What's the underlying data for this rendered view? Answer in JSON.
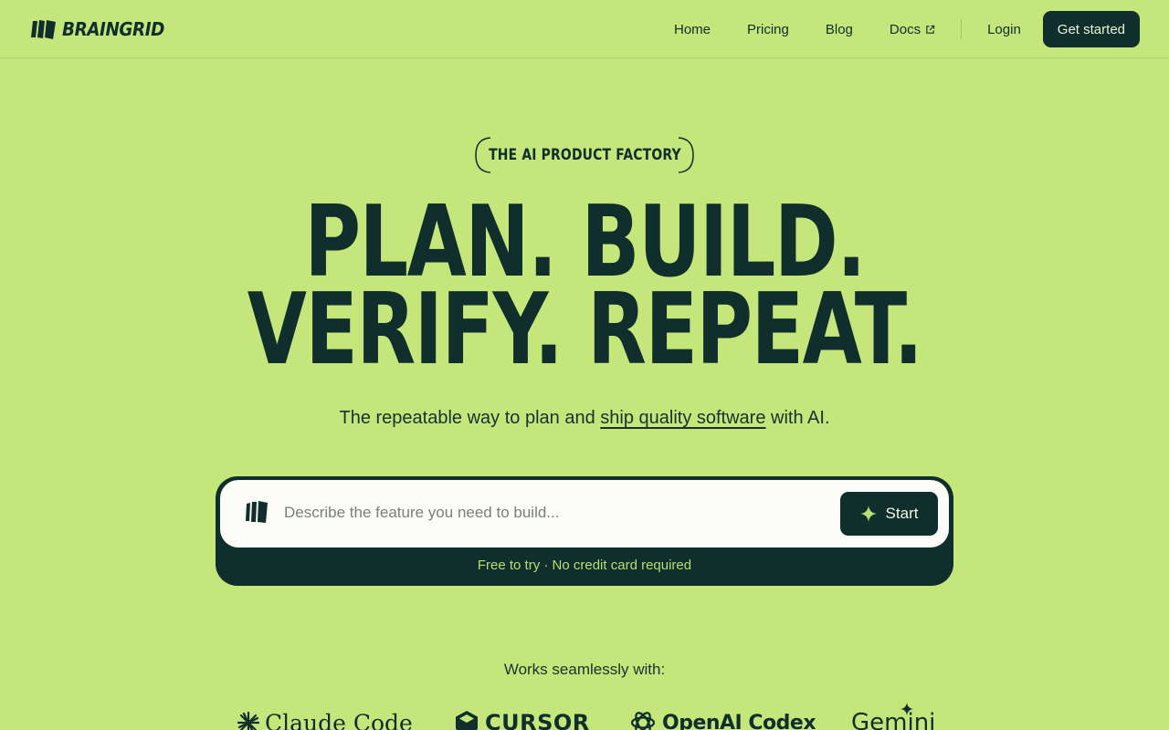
{
  "header": {
    "brand": "BRAINGRID",
    "nav": [
      {
        "label": "Home"
      },
      {
        "label": "Pricing"
      },
      {
        "label": "Blog"
      },
      {
        "label": "Docs",
        "icon": "external-link-icon"
      }
    ],
    "login_label": "Login",
    "cta_label": "Get started"
  },
  "hero": {
    "badge": "THE AI PRODUCT FACTORY",
    "headline_line1": "PLAN. BUILD.",
    "headline_line2": "VERIFY. REPEAT.",
    "subhead_before": "The repeatable way to plan and ",
    "subhead_link": "ship quality software",
    "subhead_after": " with AI."
  },
  "prompt": {
    "placeholder": "Describe the feature you need to build...",
    "value": "",
    "start_label": "Start",
    "note": "Free to try · No credit card required"
  },
  "integrations": {
    "heading": "Works seamlessly with:",
    "partners": [
      {
        "name": "Claude Code",
        "icon": "claude-starburst-icon"
      },
      {
        "name": "CURSOR",
        "icon": "cursor-cube-icon"
      },
      {
        "name": "OpenAI Codex",
        "icon": "openai-knot-icon"
      },
      {
        "name": "Gemini",
        "icon": "gemini-sparkle-icon"
      }
    ]
  },
  "colors": {
    "background": "#c5e67b",
    "dark": "#0f2e2c",
    "accent_text": "#b7df72",
    "input_bg": "#fbfbf7"
  }
}
